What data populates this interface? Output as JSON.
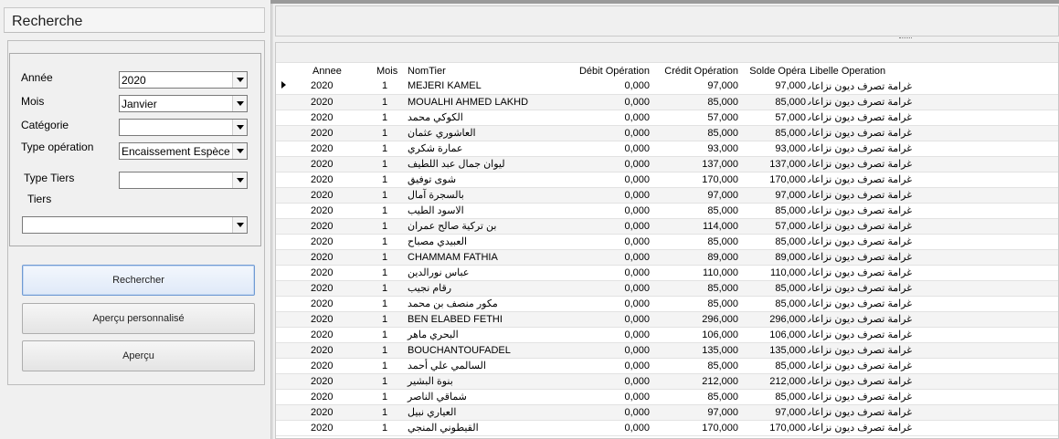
{
  "panel": {
    "title": "Recherche",
    "labels": {
      "annee": "Année",
      "mois": "Mois",
      "categorie": "Catégorie",
      "type_operation": "Type opération",
      "type_tiers": "Type Tiers",
      "tiers": "Tiers"
    },
    "values": {
      "annee": "2020",
      "mois": "Janvier",
      "categorie": "",
      "type_operation": "Encaissement Espèces",
      "type_tiers": "",
      "tiers": ""
    },
    "buttons": {
      "rechercher": "Rechercher",
      "apercu_perso": "Aperçu personnalisé",
      "apercu": "Aperçu"
    }
  },
  "grid": {
    "columns": [
      "Annee",
      "Mois",
      "NomTier",
      "Débit Opération",
      "Crédit Opération",
      "Solde Opéra",
      "Libelle Operation"
    ],
    "rows": [
      [
        "2020",
        "1",
        "MEJERI KAMEL",
        "0,000",
        "97,000",
        "97,000",
        "غرامة تصرف ديون نزاعات"
      ],
      [
        "2020",
        "1",
        "MOUALHI AHMED LAKHD",
        "0,000",
        "85,000",
        "85,000",
        "غرامة تصرف ديون نزاعات"
      ],
      [
        "2020",
        "1",
        "الكوكي محمد",
        "0,000",
        "57,000",
        "57,000",
        "غرامة تصرف ديون نزاعات"
      ],
      [
        "2020",
        "1",
        "العاشوري عثمان",
        "0,000",
        "85,000",
        "85,000",
        "غرامة تصرف ديون نزاعات"
      ],
      [
        "2020",
        "1",
        "عمارة شكري",
        "0,000",
        "93,000",
        "93,000",
        "غرامة تصرف ديون نزاعات"
      ],
      [
        "2020",
        "1",
        "ليوان جمال عبد اللطيف",
        "0,000",
        "137,000",
        "137,000",
        "غرامة تصرف ديون نزاعات"
      ],
      [
        "2020",
        "1",
        "شوى توفيق",
        "0,000",
        "170,000",
        "170,000",
        "غرامة تصرف ديون نزاعات"
      ],
      [
        "2020",
        "1",
        "بالسجرة آمال",
        "0,000",
        "97,000",
        "97,000",
        "غرامة تصرف ديون نزاعات"
      ],
      [
        "2020",
        "1",
        "الاسود الطيب",
        "0,000",
        "85,000",
        "85,000",
        "غرامة تصرف ديون نزاعات"
      ],
      [
        "2020",
        "1",
        "بن تركية صالح عمران",
        "0,000",
        "114,000",
        "57,000",
        "غرامة تصرف ديون نزاعات"
      ],
      [
        "2020",
        "1",
        "العبيدي مصباح",
        "0,000",
        "85,000",
        "85,000",
        "غرامة تصرف ديون نزاعات"
      ],
      [
        "2020",
        "1",
        "CHAMMAM FATHIA",
        "0,000",
        "89,000",
        "89,000",
        "غرامة تصرف ديون نزاعات"
      ],
      [
        "2020",
        "1",
        "عباس نورالدين",
        "0,000",
        "110,000",
        "110,000",
        "غرامة تصرف ديون نزاعات"
      ],
      [
        "2020",
        "1",
        "رقام نجيب",
        "0,000",
        "85,000",
        "85,000",
        "غرامة تصرف ديون نزاعات"
      ],
      [
        "2020",
        "1",
        "مكور منصف بن محمد",
        "0,000",
        "85,000",
        "85,000",
        "غرامة تصرف ديون نزاعات"
      ],
      [
        "2020",
        "1",
        "BEN ELABED FETHI",
        "0,000",
        "296,000",
        "296,000",
        "غرامة تصرف ديون نزاعات"
      ],
      [
        "2020",
        "1",
        "البحري ماهر",
        "0,000",
        "106,000",
        "106,000",
        "غرامة تصرف ديون نزاعات"
      ],
      [
        "2020",
        "1",
        "BOUCHANTOUFADEL",
        "0,000",
        "135,000",
        "135,000",
        "غرامة تصرف ديون نزاعات"
      ],
      [
        "2020",
        "1",
        "السالمي علي أحمد",
        "0,000",
        "85,000",
        "85,000",
        "غرامة تصرف ديون نزاعات"
      ],
      [
        "2020",
        "1",
        "بنوة البشير",
        "0,000",
        "212,000",
        "212,000",
        "غرامة تصرف ديون نزاعات"
      ],
      [
        "2020",
        "1",
        "شماقي الناصر",
        "0,000",
        "85,000",
        "85,000",
        "غرامة تصرف ديون نزاعات"
      ],
      [
        "2020",
        "1",
        "العياري نبيل",
        "0,000",
        "97,000",
        "97,000",
        "غرامة تصرف ديون نزاعات"
      ],
      [
        "2020",
        "1",
        "القيطوني المنجي",
        "0,000",
        "170,000",
        "170,000",
        "غرامة تصرف ديون نزاعات"
      ]
    ]
  }
}
